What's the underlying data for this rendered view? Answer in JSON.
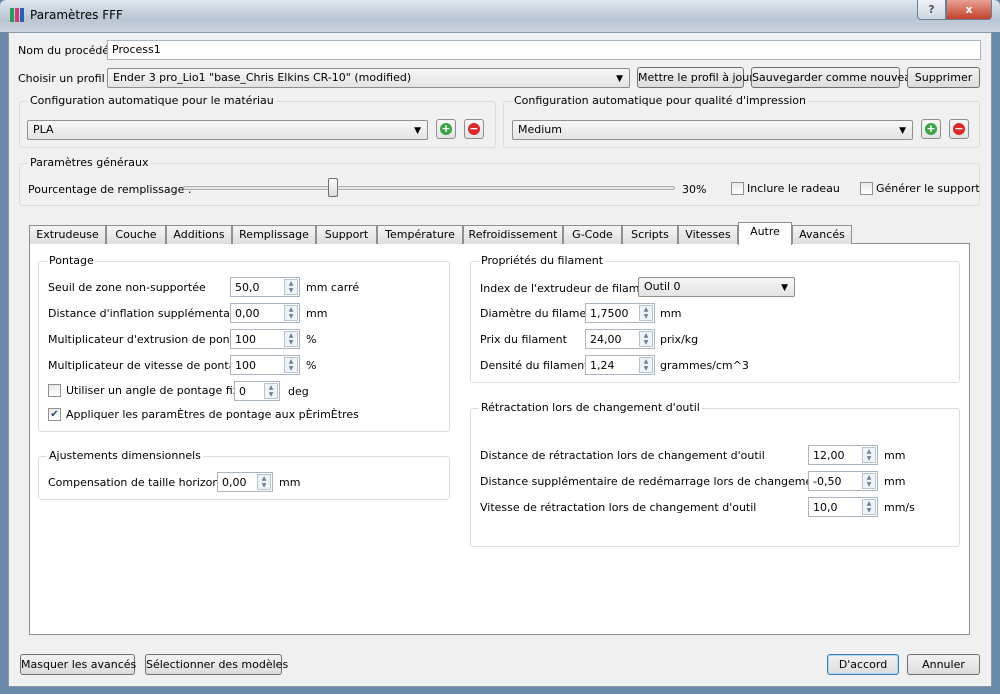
{
  "window": {
    "title": "Paramètres FFF",
    "help": "?",
    "close": "x"
  },
  "process": {
    "label": "Nom du procédé :",
    "value": "Process1"
  },
  "profile": {
    "label": "Choisir un profil :",
    "value": "Ender 3 pro_Lio1 \"base_Chris Elkins CR-10\" (modified)",
    "update": "Mettre le profil à jour",
    "save_new": "Sauvegarder comme nouveau",
    "delete": "Supprimer"
  },
  "material": {
    "title": "Configuration automatique pour le matériau",
    "value": "PLA"
  },
  "quality": {
    "title": "Configuration automatique pour qualité d'impression",
    "value": "Medium"
  },
  "general": {
    "title": "Paramètres généraux",
    "infill_label": "Pourcentage de remplissage :",
    "infill_value": "30%",
    "infill_percent": 30,
    "raft_label": "Inclure le radeau",
    "raft_checked": false,
    "support_label": "Générer le support",
    "support_checked": false
  },
  "tabs": [
    "Extrudeuse",
    "Couche",
    "Additions",
    "Remplissage",
    "Support",
    "Température",
    "Refroidissement",
    "G-Code",
    "Scripts",
    "Vitesses",
    "Autre",
    "Avancés"
  ],
  "active_tab": "Autre",
  "bridging": {
    "title": "Pontage",
    "rows": [
      {
        "label": "Seuil de zone non-supportée",
        "value": "50,0",
        "unit": "mm carré"
      },
      {
        "label": "Distance d'inflation supplémentaire",
        "value": "0,00",
        "unit": "mm"
      },
      {
        "label": "Multiplicateur d'extrusion de pontage",
        "value": "100",
        "unit": "%"
      },
      {
        "label": "Multiplicateur de vitesse de pontage",
        "value": "100",
        "unit": "%"
      }
    ],
    "fixed_angle": {
      "label": "Utiliser un angle de pontage fixe.",
      "checked": false,
      "value": "0",
      "unit": "deg"
    },
    "apply_perimeters": {
      "label": "Appliquer les paramÈtres de pontage aux pÈrimÈtres",
      "checked": true
    }
  },
  "dimensional": {
    "title": "Ajustements dimensionnels",
    "label": "Compensation de taille horizontale",
    "value": "0,00",
    "unit": "mm"
  },
  "filament": {
    "title": "Propriétés du filament",
    "index_label": "Index de l'extrudeur de filament",
    "index_value": "Outil 0",
    "rows": [
      {
        "label": "Diamètre du filament",
        "value": "1,7500",
        "unit": "mm"
      },
      {
        "label": "Prix du filament",
        "value": "24,00",
        "unit": "prix/kg"
      },
      {
        "label": "Densité du filament",
        "value": "1,24",
        "unit": "grammes/cm^3"
      }
    ]
  },
  "retraction": {
    "title": "Rétractation lors de changement d'outil",
    "rows": [
      {
        "label": "Distance de rétractation lors de changement d'outil",
        "value": "12,00",
        "unit": "mm"
      },
      {
        "label": "Distance supplémentaire de redémarrage lors de changement d'outil",
        "value": "-0,50",
        "unit": "mm"
      },
      {
        "label": "Vitesse de rétractation lors de changement d'outil",
        "value": "10,0",
        "unit": "mm/s"
      }
    ]
  },
  "footer": {
    "hide_advanced": "Masquer les avancés",
    "select_models": "Sélectionner des modèles",
    "ok": "D'accord",
    "cancel": "Annuler"
  }
}
